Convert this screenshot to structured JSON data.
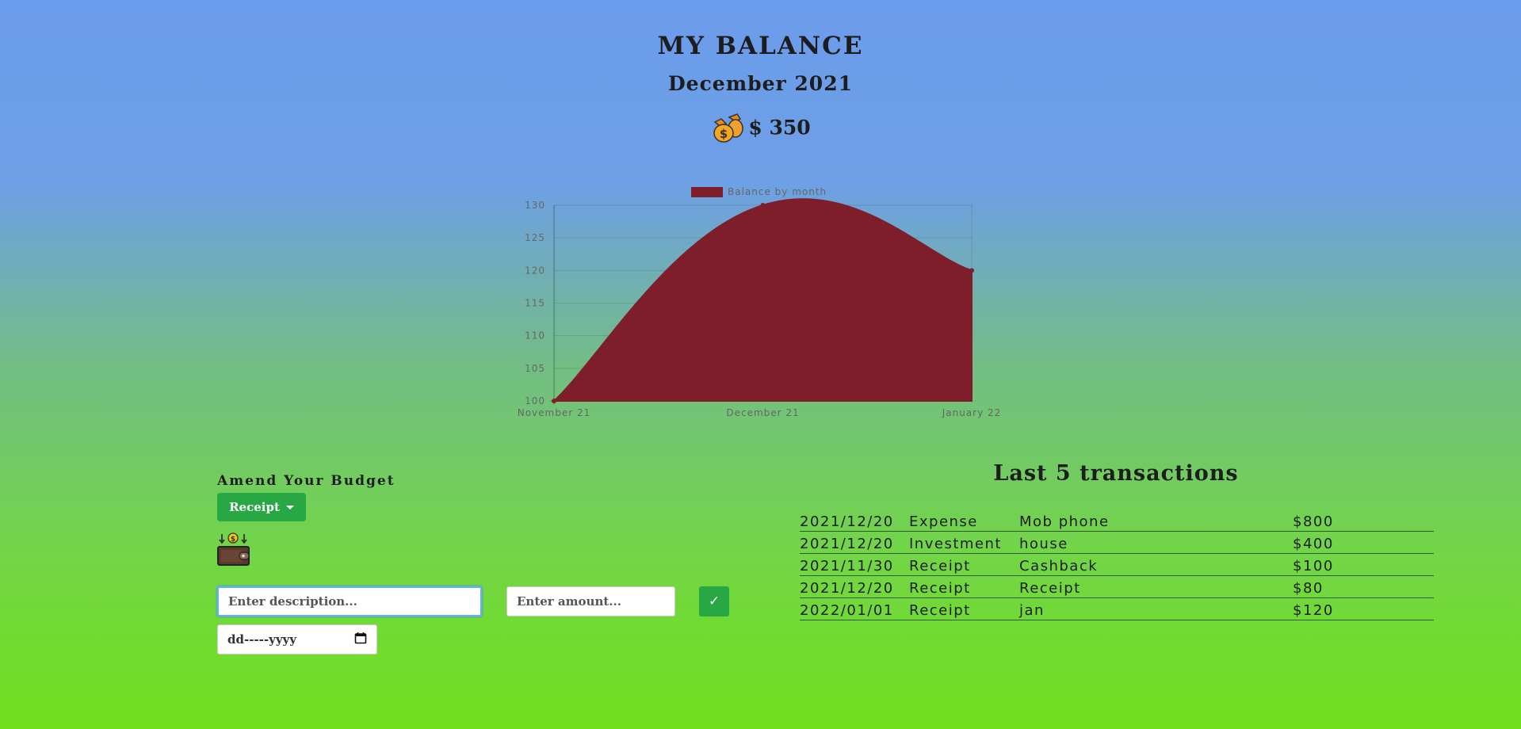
{
  "header": {
    "title": "MY BALANCE",
    "month": "December 2021",
    "balance": "$ 350",
    "balance_icon": "money-bags-icon"
  },
  "chart_data": {
    "type": "area",
    "legend": [
      "Balance by month"
    ],
    "legend_placement": "top",
    "categories": [
      "November 21",
      "December 21",
      "January 22"
    ],
    "series": [
      {
        "name": "Balance by month",
        "values": [
          100,
          130,
          120
        ],
        "color": "#7f1e2b"
      }
    ],
    "y_ticks": [
      100,
      105,
      110,
      115,
      120,
      125,
      130
    ],
    "ylim": [
      100,
      130
    ],
    "grid": true
  },
  "amend": {
    "title": "Amend Your Budget",
    "type_select": "Receipt",
    "wallet_icon": "wallet-icon",
    "description_placeholder": "Enter description...",
    "amount_placeholder": "Enter amount...",
    "submit_label": "✓",
    "date_placeholder": "dd-----yyyy"
  },
  "transactions": {
    "title": "Last 5 transactions",
    "rows": [
      {
        "date": "2021/12/20",
        "type": "Expense",
        "description": "Mob phone",
        "amount": "$800"
      },
      {
        "date": "2021/12/20",
        "type": "Investment",
        "description": "house",
        "amount": "$400"
      },
      {
        "date": "2021/11/30",
        "type": "Receipt",
        "description": "Cashback",
        "amount": "$100"
      },
      {
        "date": "2021/12/20",
        "type": "Receipt",
        "description": "Receipt",
        "amount": "$80"
      },
      {
        "date": "2022/01/01",
        "type": "Receipt",
        "description": "jan",
        "amount": "$120"
      }
    ]
  },
  "colors": {
    "accent_green": "#28a745",
    "chart_fill": "#7f1e2b"
  }
}
